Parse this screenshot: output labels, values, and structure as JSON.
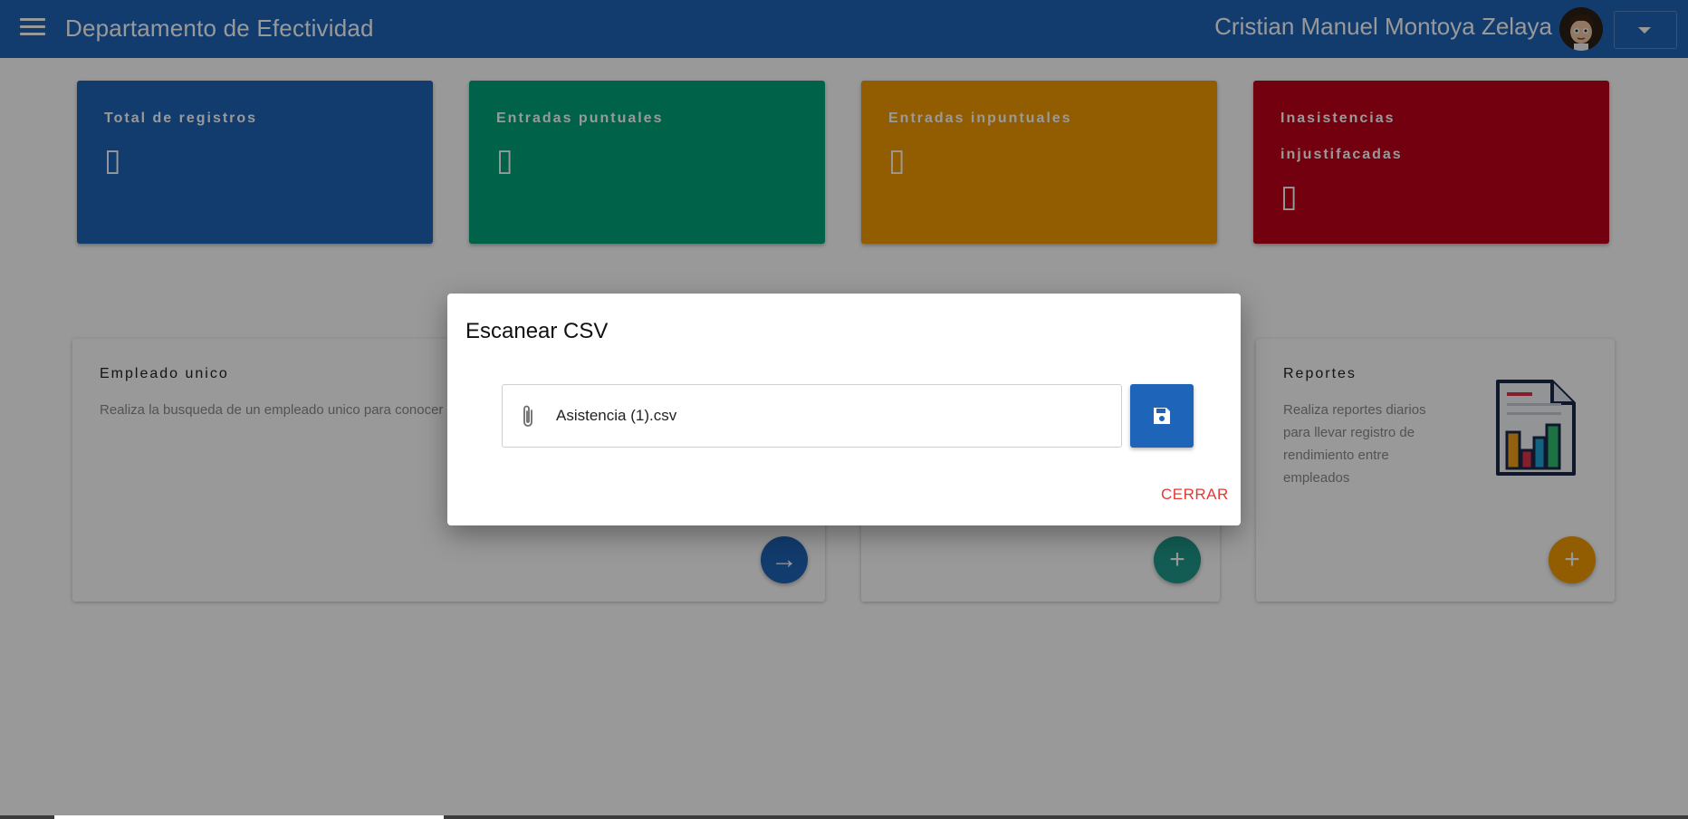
{
  "header": {
    "title": "Departamento de Efectividad",
    "user_name": "Cristian Manuel Montoya Zelaya"
  },
  "stats": [
    {
      "label": "Total de registros",
      "value": "▯",
      "color": "#1e64b8"
    },
    {
      "label": "Entradas puntuales",
      "value": "▯",
      "color": "#00a37a"
    },
    {
      "label": "Entradas inpuntuales",
      "value": "▯",
      "color": "#f39a00"
    },
    {
      "label": "Inasistencias injustifacadas",
      "value": "▯",
      "color": "#c0001a"
    }
  ],
  "cards": {
    "empleado": {
      "title": "Empleado unico",
      "description": "Realiza la busqueda de un empleado unico para conocer su record de asistencia",
      "action_icon": "arrow-right-icon",
      "action_color": "#1e64b8",
      "action_symbol": "→"
    },
    "scan": {
      "action_icon": "plus-icon",
      "action_color": "#1f9a8a",
      "action_symbol": "+"
    },
    "reportes": {
      "title": "Reportes",
      "description": "Realiza reportes diarios para llevar registro de rendimiento entre empleados",
      "illustration": "report-chart-icon",
      "action_icon": "plus-icon",
      "action_color": "#f39a00",
      "action_symbol": "+"
    }
  },
  "dialog": {
    "title": "Escanear CSV",
    "file_name": "Asistencia (1).csv",
    "attach_icon": "paperclip-icon",
    "save_icon": "floppy-disk-icon",
    "close_label": "CERRAR",
    "close_color": "#e53935"
  }
}
